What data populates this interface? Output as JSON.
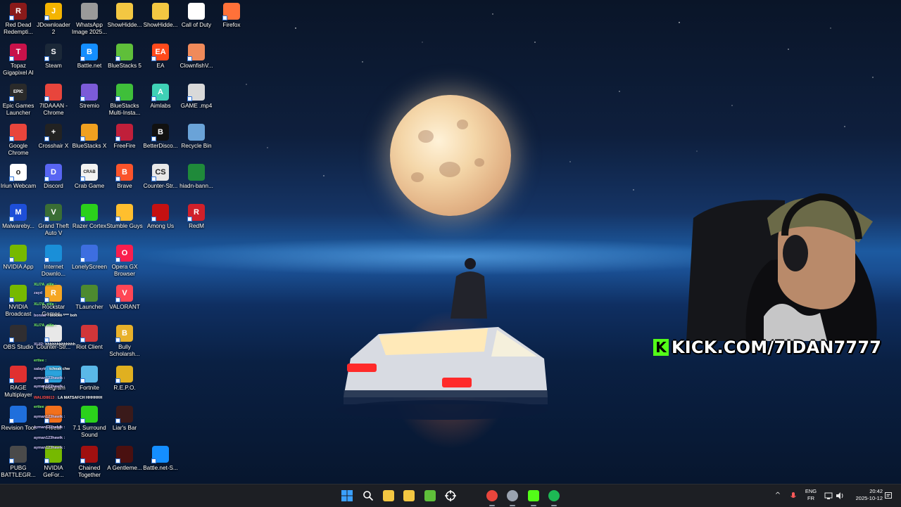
{
  "desktop": {
    "icons": [
      {
        "label": "Red Dead Redempti...",
        "icon": "red-dead-redemption-icon",
        "color": "#8a1a1a",
        "glyph": "R"
      },
      {
        "label": "JDownloader 2",
        "icon": "jdownloader-icon",
        "color": "#f4b400",
        "glyph": "J"
      },
      {
        "label": "WhatsApp Image 2025...",
        "icon": "image-file-icon",
        "color": "#9a9a9a",
        "glyph": ""
      },
      {
        "label": "ShowHidde...",
        "icon": "folder-icon",
        "color": "#f3c742",
        "glyph": ""
      },
      {
        "label": "ShowHidde...",
        "icon": "folder-icon",
        "color": "#f3c742",
        "glyph": ""
      },
      {
        "label": "Call of Duty",
        "icon": "file-icon",
        "color": "#ffffff",
        "glyph": ""
      },
      {
        "label": "Firefox",
        "icon": "firefox-icon",
        "color": "#ff7139",
        "glyph": ""
      },
      {
        "label": "Topaz Gigapixel AI",
        "icon": "topaz-gigapixel-icon",
        "color": "#c8124a",
        "glyph": "T"
      },
      {
        "label": "Steam",
        "icon": "steam-icon",
        "color": "#1b2838",
        "glyph": "S"
      },
      {
        "label": "Battle.net",
        "icon": "battlenet-icon",
        "color": "#148eff",
        "glyph": "B"
      },
      {
        "label": "BlueStacks 5",
        "icon": "bluestacks-icon",
        "color": "#5fbf3a",
        "glyph": ""
      },
      {
        "label": "EA",
        "icon": "ea-icon",
        "color": "#ff4a1c",
        "glyph": "EA"
      },
      {
        "label": "ClownfishV...",
        "icon": "clownfish-icon",
        "color": "#f08a5a",
        "glyph": ""
      },
      {
        "label": "Epic Games Launcher",
        "icon": "epic-games-icon",
        "color": "#2a2a2a",
        "glyph": "EPIC"
      },
      {
        "label": "7IDAAAN - Chrome",
        "icon": "chrome-icon",
        "color": "#e8453c",
        "glyph": ""
      },
      {
        "label": "Stremio",
        "icon": "stremio-icon",
        "color": "#7b5bd8",
        "glyph": ""
      },
      {
        "label": "BlueStacks Multi-Insta...",
        "icon": "bluestacks-multi-icon",
        "color": "#3fbf3a",
        "glyph": ""
      },
      {
        "label": "Aimlabs",
        "icon": "aimlabs-icon",
        "color": "#3fd1b6",
        "glyph": "A"
      },
      {
        "label": "GAME .mp4",
        "icon": "video-file-icon",
        "color": "#d9d9d9",
        "glyph": ""
      },
      {
        "label": "Google Chrome",
        "icon": "chrome-icon",
        "color": "#e8453c",
        "glyph": ""
      },
      {
        "label": "Crosshair X",
        "icon": "crosshair-icon",
        "color": "#222222",
        "glyph": "+"
      },
      {
        "label": "BlueStacks X",
        "icon": "bluestacks-x-icon",
        "color": "#f0a020",
        "glyph": ""
      },
      {
        "label": "FreeFire",
        "icon": "freefire-icon",
        "color": "#c01f3a",
        "glyph": ""
      },
      {
        "label": "BetterDisco...",
        "icon": "betterdiscord-icon",
        "color": "#111111",
        "glyph": "B"
      },
      {
        "label": "Recycle Bin",
        "icon": "recycle-bin-icon",
        "color": "#6aa3d8",
        "glyph": ""
      },
      {
        "label": "Iriun Webcam",
        "icon": "iriun-webcam-icon",
        "color": "#ffffff",
        "glyph": "o"
      },
      {
        "label": "Discord",
        "icon": "discord-icon",
        "color": "#5865f2",
        "glyph": "D"
      },
      {
        "label": "Crab Game",
        "icon": "crab-game-icon",
        "color": "#f2f2f2",
        "glyph": "CRAB"
      },
      {
        "label": "Brave",
        "icon": "brave-icon",
        "color": "#fb542b",
        "glyph": "B"
      },
      {
        "label": "Counter-Str...",
        "icon": "counter-strike-icon",
        "color": "#e8e8e8",
        "glyph": "CS"
      },
      {
        "label": "hiadn-bann...",
        "icon": "file-icon",
        "color": "#1f8a3a",
        "glyph": ""
      },
      {
        "label": "Malwareby...",
        "icon": "malwarebytes-icon",
        "color": "#1e4fd8",
        "glyph": "M"
      },
      {
        "label": "Grand Theft Auto V",
        "icon": "gta-v-icon",
        "color": "#3a6e35",
        "glyph": "V"
      },
      {
        "label": "Razer Cortex",
        "icon": "razer-cortex-icon",
        "color": "#2bd11b",
        "glyph": ""
      },
      {
        "label": "Stumble Guys",
        "icon": "stumble-guys-icon",
        "color": "#ffbf2e",
        "glyph": ""
      },
      {
        "label": "Among Us",
        "icon": "among-us-icon",
        "color": "#c51111",
        "glyph": ""
      },
      {
        "label": "RedM",
        "icon": "redm-icon",
        "color": "#d0202a",
        "glyph": "R"
      },
      {
        "label": "NVIDIA App",
        "icon": "nvidia-icon",
        "color": "#76b900",
        "glyph": ""
      },
      {
        "label": "Internet Downlo...",
        "icon": "internet-download-manager-icon",
        "color": "#1a8fd8",
        "glyph": ""
      },
      {
        "label": "LonelyScreen",
        "icon": "lonelyscreen-icon",
        "color": "#3d6ee0",
        "glyph": ""
      },
      {
        "label": "Opera GX Browser",
        "icon": "opera-gx-icon",
        "color": "#fa1e4e",
        "glyph": "O"
      },
      {
        "label": "NVIDIA Broadcast",
        "icon": "nvidia-broadcast-icon",
        "color": "#76b900",
        "glyph": ""
      },
      {
        "label": "Rockstar Games...",
        "icon": "rockstar-icon",
        "color": "#f5a623",
        "glyph": "R"
      },
      {
        "label": "TLauncher",
        "icon": "tlauncher-icon",
        "color": "#4d8a2f",
        "glyph": ""
      },
      {
        "label": "VALORANT",
        "icon": "valorant-icon",
        "color": "#ff4655",
        "glyph": "V"
      },
      {
        "label": "OBS Studio",
        "icon": "obs-icon",
        "color": "#302e31",
        "glyph": ""
      },
      {
        "label": "Counter-Str...",
        "icon": "counter-strike-icon",
        "color": "#e8e8e8",
        "glyph": ""
      },
      {
        "label": "Riot Client",
        "icon": "riot-client-icon",
        "color": "#d13639",
        "glyph": ""
      },
      {
        "label": "Bully Scholarsh...",
        "icon": "bully-icon",
        "color": "#e8b12a",
        "glyph": "B"
      },
      {
        "label": "RAGE Multiplayer",
        "icon": "rage-mp-icon",
        "color": "#e03030",
        "glyph": ""
      },
      {
        "label": "Telegram",
        "icon": "telegram-icon",
        "color": "#2aa3dd",
        "glyph": ""
      },
      {
        "label": "Fortnite",
        "icon": "fortnite-icon",
        "color": "#5ab8e8",
        "glyph": ""
      },
      {
        "label": "R.E.P.O.",
        "icon": "repo-icon",
        "color": "#e0b020",
        "glyph": ""
      },
      {
        "label": "Revision Tool",
        "icon": "revision-tool-icon",
        "color": "#1f6fdc",
        "glyph": ""
      },
      {
        "label": "FiveM",
        "icon": "fivem-icon",
        "color": "#f2701c",
        "glyph": ""
      },
      {
        "label": "7.1 Surround Sound",
        "icon": "surround-sound-icon",
        "color": "#2bd11b",
        "glyph": ""
      },
      {
        "label": "Liar's Bar",
        "icon": "liars-bar-icon",
        "color": "#3a1a1a",
        "glyph": ""
      },
      {
        "label": "PUBG BATTLEGR...",
        "icon": "pubg-icon",
        "color": "#4a4a4a",
        "glyph": ""
      },
      {
        "label": "NVIDIA GeFor...",
        "icon": "nvidia-geforce-icon",
        "color": "#76b900",
        "glyph": ""
      },
      {
        "label": "Chained Together",
        "icon": "chained-together-icon",
        "color": "#a01010",
        "glyph": ""
      },
      {
        "label": "A Gentleme...",
        "icon": "a-gentlemen-icon",
        "color": "#4a1010",
        "glyph": ""
      },
      {
        "label": "Battle.net-S...",
        "icon": "battlenet-icon",
        "color": "#148eff",
        "glyph": ""
      }
    ]
  },
  "chat": [
    {
      "user": "XLI7A_elile :",
      "msg": "",
      "cls": "u"
    },
    {
      "user": "zayd ",
      "msg": "",
      "cls": "u2"
    },
    {
      "user": "XLI7A_elile :",
      "msg": "",
      "cls": "u"
    },
    {
      "user": "bonsar :",
      "msg": "blockti **** boh",
      "cls": "u2"
    },
    {
      "user": "XLI7A_elile :",
      "msg": "",
      "cls": "u"
    },
    {
      "user": "",
      "msg": "",
      "cls": "u2"
    },
    {
      "user": "XLIl2:",
      "msg": "hhhhhhhhhhhhh",
      "cls": "u2"
    },
    {
      "user": "",
      "msg": "",
      "cls": "u2"
    },
    {
      "user": "erttee :",
      "msg": "",
      "cls": "u"
    },
    {
      "user": "salaytr :",
      "msg": "tcheak chw",
      "cls": "u2"
    },
    {
      "user": "ayman123hawik :",
      "msg": "",
      "cls": "u2"
    },
    {
      "user": "ayman123hawik :",
      "msg": "",
      "cls": "u2"
    },
    {
      "user": "WALID8613 :",
      "msg": "LA MATSAFCH HHHHHH",
      "cls": "u3"
    },
    {
      "user": "erttee :",
      "msg": "",
      "cls": "u"
    },
    {
      "user": "ayman123hawik :",
      "msg": "",
      "cls": "u2"
    },
    {
      "user": "ayman123hawik :",
      "msg": "",
      "cls": "u2"
    },
    {
      "user": "ayman123hawik :",
      "msg": "",
      "cls": "u2"
    },
    {
      "user": "ayman123hawik :",
      "msg": "",
      "cls": "u2"
    }
  ],
  "stream": {
    "kick_logo": "K",
    "kick_url": "KICK.COM/7IDAN7777"
  },
  "taskbar": {
    "apps": [
      {
        "name": "start-button",
        "icon": "windows-logo-icon",
        "color": "#3aa0ff"
      },
      {
        "name": "search-button",
        "icon": "search-icon",
        "color": "#ffffff"
      },
      {
        "name": "file-explorer-button",
        "icon": "folder-icon",
        "color": "#f3c742"
      },
      {
        "name": "microsoft-store-button",
        "icon": "store-icon",
        "color": "#f3c742"
      },
      {
        "name": "bluestacks-button",
        "icon": "bluestacks-icon",
        "color": "#5fbf3a"
      },
      {
        "name": "crosshair-button",
        "icon": "crosshair-icon",
        "color": "#ffffff"
      },
      {
        "name": "chrome-button",
        "icon": "chrome-icon",
        "color": "#e8453c"
      },
      {
        "name": "steam-button",
        "icon": "steam-icon",
        "color": "#9aa3b0"
      },
      {
        "name": "kick-studio-button",
        "icon": "kick-icon",
        "color": "#53fc18"
      },
      {
        "name": "spotify-button",
        "icon": "spotify-icon",
        "color": "#1db954"
      }
    ],
    "tray": {
      "chevron": "^",
      "lang_top": "ENG",
      "lang_bottom": "FR",
      "time": "20:42",
      "date": "2025-10-12"
    }
  }
}
